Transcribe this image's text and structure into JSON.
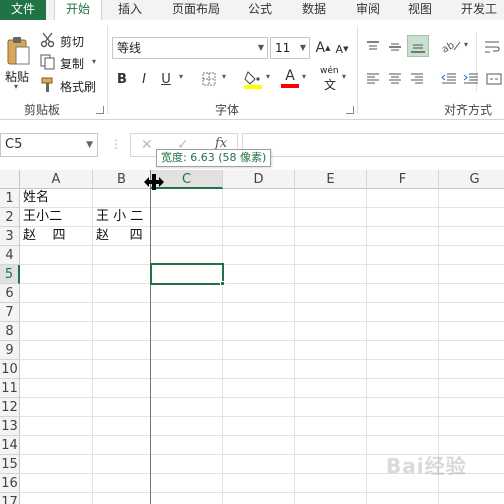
{
  "tabs": [
    {
      "label": "文件"
    },
    {
      "label": "开始"
    },
    {
      "label": "插入"
    },
    {
      "label": "页面布局"
    },
    {
      "label": "公式"
    },
    {
      "label": "数据"
    },
    {
      "label": "审阅"
    },
    {
      "label": "视图"
    },
    {
      "label": "开发工"
    }
  ],
  "clipboard": {
    "paste_label": "粘贴",
    "cut_label": "剪切",
    "copy_label": "复制",
    "format_painter_label": "格式刷",
    "group_label": "剪贴板"
  },
  "font": {
    "font_name": "等线",
    "font_size": "11",
    "bold": "B",
    "italic": "I",
    "underline": "U",
    "grow": "A",
    "shrink": "A",
    "font_color_glyph": "A",
    "phonetic": "wén",
    "group_label": "字体",
    "accent_fill": "#ffff00",
    "accent_font": "#ff0000"
  },
  "alignment": {
    "group_label": "对齐方式"
  },
  "formula_bar": {
    "name_box": "C5",
    "cancel": "✕",
    "enter": "✓",
    "fx": "fx",
    "value": ""
  },
  "tooltip": {
    "text": "宽度: 6.63 (58 像素)"
  },
  "columns": [
    "A",
    "B",
    "C",
    "D",
    "E",
    "F",
    "G"
  ],
  "rows": [
    "1",
    "2",
    "3",
    "4",
    "5",
    "6",
    "7",
    "8",
    "9",
    "10",
    "11",
    "12",
    "13",
    "14",
    "15",
    "16",
    "17"
  ],
  "cells": {
    "A1": "姓名",
    "A2": "王小二",
    "A3": "赵    四",
    "B2": "王 小 二",
    "B3": "赵     四"
  },
  "active_cell": "C5",
  "selected_column": "C",
  "selected_row": "5",
  "colors": {
    "brand": "#217346",
    "selection": "#217346"
  },
  "watermark": "Bai经验"
}
